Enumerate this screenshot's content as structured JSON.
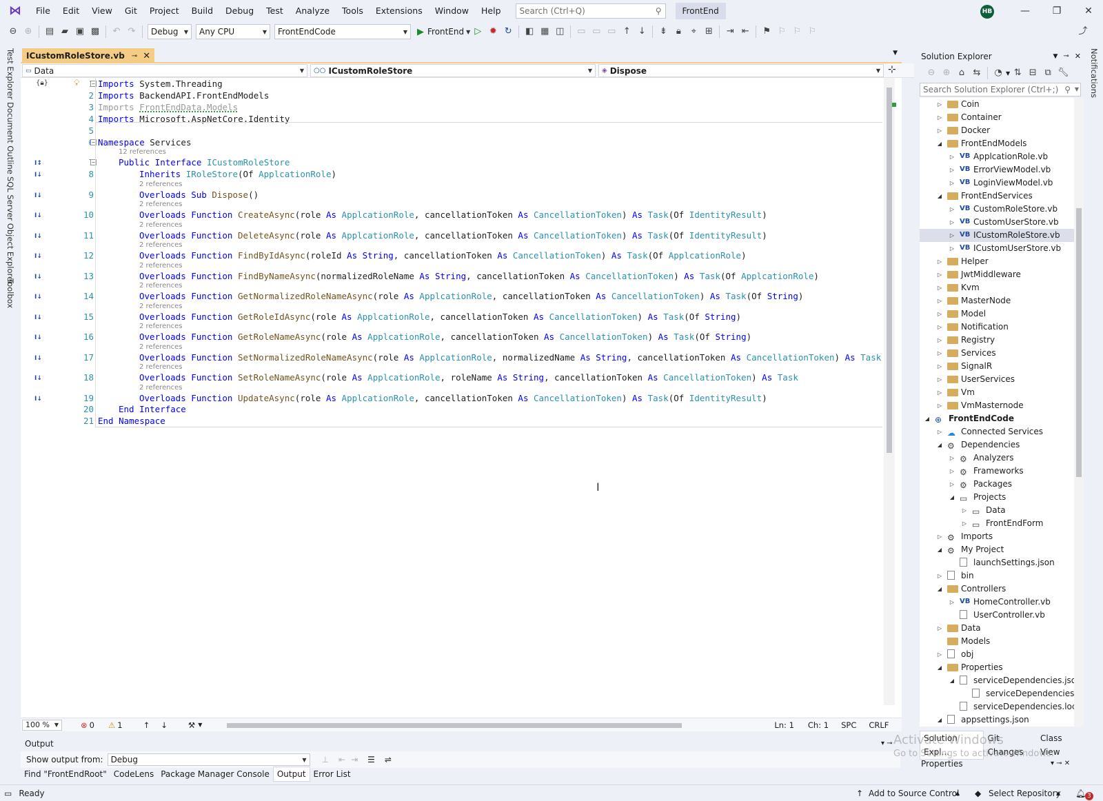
{
  "menu": [
    "File",
    "Edit",
    "View",
    "Git",
    "Project",
    "Build",
    "Debug",
    "Test",
    "Analyze",
    "Tools",
    "Extensions",
    "Window",
    "Help"
  ],
  "search": {
    "placeholder": "Search (Ctrl+Q)"
  },
  "solution_name": "FrontEnd",
  "user_initials": "HB",
  "toolbar": {
    "config": "Debug",
    "platform": "Any CPU",
    "startup_project": "FrontEndCode",
    "run_label": "FrontEnd"
  },
  "left_rail": [
    "Test Explorer",
    "Document Outline",
    "SQL Server Object Explorer",
    "Toolbox"
  ],
  "right_rail": [
    "Notifications"
  ],
  "editor": {
    "tab_title": "ICustomRoleStore.vb",
    "nav": {
      "project": "Data",
      "type": "ICustomRoleStore",
      "member": "Dispose"
    },
    "lines": [
      {
        "n": "1",
        "spans": [
          [
            "kw",
            "Imports"
          ],
          [
            "",
            "System.Threading"
          ]
        ]
      },
      {
        "n": "2",
        "spans": [
          [
            "kw",
            "Imports"
          ],
          [
            "",
            "BackendAPI.FrontEndModels"
          ]
        ]
      },
      {
        "n": "3",
        "spans": [
          [
            "dim",
            "Imports"
          ],
          [
            "dim",
            "FrontEndData.Models"
          ]
        ]
      },
      {
        "n": "4",
        "spans": [
          [
            "kw",
            "Imports"
          ],
          [
            "",
            "Microsoft.AspNetCore.Identity"
          ]
        ]
      },
      {
        "n": "5",
        "spans": []
      },
      {
        "n": "6",
        "spans": [
          [
            "kw",
            "Namespace"
          ],
          [
            "",
            "Services"
          ]
        ]
      },
      {
        "n": "7",
        "lens": "12 references",
        "spans": [
          [
            "kw",
            "Public Interface"
          ],
          [
            "ty",
            "ICustomRoleStore"
          ]
        ]
      },
      {
        "n": "8",
        "spans": [
          [
            "kw",
            "Inherits"
          ],
          [
            "ty",
            "IRoleStore"
          ],
          [
            "",
            "(Of "
          ],
          [
            "ty",
            "ApplcationRole"
          ],
          [
            "",
            ")"
          ]
        ]
      },
      {
        "n": "9",
        "lens": "2 references",
        "spans": [
          [
            "kw",
            "Overloads Sub"
          ],
          [
            "fn",
            "Dispose"
          ],
          [
            "",
            "()"
          ]
        ]
      },
      {
        "n": "10",
        "lens": "2 references",
        "spans": [
          [
            "kw",
            "Overloads Function"
          ],
          [
            "fn",
            "CreateAsync"
          ],
          [
            "",
            "(role "
          ],
          [
            "kw",
            "As"
          ],
          [
            "ty",
            "ApplcationRole"
          ],
          [
            "",
            ", cancellationToken "
          ],
          [
            "kw",
            "As"
          ],
          [
            "ty",
            "CancellationToken"
          ],
          [
            "",
            ") "
          ],
          [
            "kw",
            "As"
          ],
          [
            "ty",
            "Task"
          ],
          [
            "",
            "(Of "
          ],
          [
            "ty",
            "IdentityResult"
          ],
          [
            "",
            ")"
          ]
        ]
      },
      {
        "n": "11",
        "lens": "2 references",
        "spans": [
          [
            "kw",
            "Overloads Function"
          ],
          [
            "fn",
            "DeleteAsync"
          ],
          [
            "",
            "(role "
          ],
          [
            "kw",
            "As"
          ],
          [
            "ty",
            "ApplcationRole"
          ],
          [
            "",
            ", cancellationToken "
          ],
          [
            "kw",
            "As"
          ],
          [
            "ty",
            "CancellationToken"
          ],
          [
            "",
            ") "
          ],
          [
            "kw",
            "As"
          ],
          [
            "ty",
            "Task"
          ],
          [
            "",
            "(Of "
          ],
          [
            "ty",
            "IdentityResult"
          ],
          [
            "",
            ")"
          ]
        ]
      },
      {
        "n": "12",
        "lens": "2 references",
        "spans": [
          [
            "kw",
            "Overloads Function"
          ],
          [
            "fn",
            "FindByIdAsync"
          ],
          [
            "",
            "(roleId "
          ],
          [
            "kw",
            "As String"
          ],
          [
            "",
            ", cancellationToken "
          ],
          [
            "kw",
            "As"
          ],
          [
            "ty",
            "CancellationToken"
          ],
          [
            "",
            ") "
          ],
          [
            "kw",
            "As"
          ],
          [
            "ty",
            "Task"
          ],
          [
            "",
            "(Of "
          ],
          [
            "ty",
            "ApplcationRole"
          ],
          [
            "",
            ")"
          ]
        ]
      },
      {
        "n": "13",
        "lens": "2 references",
        "spans": [
          [
            "kw",
            "Overloads Function"
          ],
          [
            "fn",
            "FindByNameAsync"
          ],
          [
            "",
            "(normalizedRoleName "
          ],
          [
            "kw",
            "As String"
          ],
          [
            "",
            ", cancellationToken "
          ],
          [
            "kw",
            "As"
          ],
          [
            "ty",
            "CancellationToken"
          ],
          [
            "",
            ") "
          ],
          [
            "kw",
            "As"
          ],
          [
            "ty",
            "Task"
          ],
          [
            "",
            "(Of "
          ],
          [
            "ty",
            "ApplcationRole"
          ],
          [
            "",
            ")"
          ]
        ]
      },
      {
        "n": "14",
        "lens": "2 references",
        "spans": [
          [
            "kw",
            "Overloads Function"
          ],
          [
            "fn",
            "GetNormalizedRoleNameAsync"
          ],
          [
            "",
            "(role "
          ],
          [
            "kw",
            "As"
          ],
          [
            "ty",
            "ApplcationRole"
          ],
          [
            "",
            ", cancellationToken "
          ],
          [
            "kw",
            "As"
          ],
          [
            "ty",
            "CancellationToken"
          ],
          [
            "",
            ") "
          ],
          [
            "kw",
            "As"
          ],
          [
            "ty",
            "Task"
          ],
          [
            "",
            "(Of "
          ],
          [
            "kw",
            "String"
          ],
          [
            "",
            ")"
          ]
        ]
      },
      {
        "n": "15",
        "lens": "2 references",
        "spans": [
          [
            "kw",
            "Overloads Function"
          ],
          [
            "fn",
            "GetRoleIdAsync"
          ],
          [
            "",
            "(role "
          ],
          [
            "kw",
            "As"
          ],
          [
            "ty",
            "ApplcationRole"
          ],
          [
            "",
            ", cancellationToken "
          ],
          [
            "kw",
            "As"
          ],
          [
            "ty",
            "CancellationToken"
          ],
          [
            "",
            ") "
          ],
          [
            "kw",
            "As"
          ],
          [
            "ty",
            "Task"
          ],
          [
            "",
            "(Of "
          ],
          [
            "kw",
            "String"
          ],
          [
            "",
            ")"
          ]
        ]
      },
      {
        "n": "16",
        "lens": "2 references",
        "spans": [
          [
            "kw",
            "Overloads Function"
          ],
          [
            "fn",
            "GetRoleNameAsync"
          ],
          [
            "",
            "(role "
          ],
          [
            "kw",
            "As"
          ],
          [
            "ty",
            "ApplcationRole"
          ],
          [
            "",
            ", cancellationToken "
          ],
          [
            "kw",
            "As"
          ],
          [
            "ty",
            "CancellationToken"
          ],
          [
            "",
            ") "
          ],
          [
            "kw",
            "As"
          ],
          [
            "ty",
            "Task"
          ],
          [
            "",
            "(Of "
          ],
          [
            "kw",
            "String"
          ],
          [
            "",
            ")"
          ]
        ]
      },
      {
        "n": "17",
        "lens": "2 references",
        "spans": [
          [
            "kw",
            "Overloads Function"
          ],
          [
            "fn",
            "SetNormalizedRoleNameAsync"
          ],
          [
            "",
            "(role "
          ],
          [
            "kw",
            "As"
          ],
          [
            "ty",
            "ApplcationRole"
          ],
          [
            "",
            ", normalizedName "
          ],
          [
            "kw",
            "As String"
          ],
          [
            "",
            ", cancellationToken "
          ],
          [
            "kw",
            "As"
          ],
          [
            "ty",
            "CancellationToken"
          ],
          [
            "",
            ") "
          ],
          [
            "kw",
            "As"
          ],
          [
            "ty",
            "Task"
          ]
        ]
      },
      {
        "n": "18",
        "lens": "2 references",
        "spans": [
          [
            "kw",
            "Overloads Function"
          ],
          [
            "fn",
            "SetRoleNameAsync"
          ],
          [
            "",
            "(role "
          ],
          [
            "kw",
            "As"
          ],
          [
            "ty",
            "ApplcationRole"
          ],
          [
            "",
            ", roleName "
          ],
          [
            "kw",
            "As String"
          ],
          [
            "",
            ", cancellationToken "
          ],
          [
            "kw",
            "As"
          ],
          [
            "ty",
            "CancellationToken"
          ],
          [
            "",
            ") "
          ],
          [
            "kw",
            "As"
          ],
          [
            "ty",
            "Task"
          ]
        ]
      },
      {
        "n": "19",
        "lens": "2 references",
        "spans": [
          [
            "kw",
            "Overloads Function"
          ],
          [
            "fn",
            "UpdateAsync"
          ],
          [
            "",
            "(role "
          ],
          [
            "kw",
            "As"
          ],
          [
            "ty",
            "ApplcationRole"
          ],
          [
            "",
            ", cancellationToken "
          ],
          [
            "kw",
            "As"
          ],
          [
            "ty",
            "CancellationToken"
          ],
          [
            "",
            ") "
          ],
          [
            "kw",
            "As"
          ],
          [
            "ty",
            "Task"
          ],
          [
            "",
            "(Of "
          ],
          [
            "ty",
            "IdentityResult"
          ],
          [
            "",
            ")"
          ]
        ]
      },
      {
        "n": "20",
        "spans": [
          [
            "kw",
            "End Interface"
          ]
        ]
      },
      {
        "n": "21",
        "spans": [
          [
            "kw",
            "End Namespace"
          ]
        ]
      }
    ],
    "status": {
      "zoom": "100 %",
      "errors": "0",
      "warnings": "1",
      "ln": "Ln: 1",
      "ch": "Ch: 1",
      "spc": "SPC",
      "eol": "CRLF"
    }
  },
  "output": {
    "title": "Output",
    "show_from_label": "Show output from:",
    "source": "Debug"
  },
  "bottom_tabs": [
    "Find \"FrontEndRoot\"",
    "CodeLens",
    "Package Manager Console",
    "Output",
    "Error List"
  ],
  "status_bar": {
    "ready": "Ready",
    "source_control": "Add to Source Control",
    "repo": "Select Repository",
    "notifications": "3"
  },
  "solution_explorer": {
    "title": "Solution Explorer",
    "search_placeholder": "Search Solution Explorer (Ctrl+;)",
    "items": [
      {
        "label": "Coin",
        "level": 2,
        "type": "folder",
        "arrow": "collapsed"
      },
      {
        "label": "Container",
        "level": 2,
        "type": "folder",
        "arrow": "collapsed"
      },
      {
        "label": "Docker",
        "level": 2,
        "type": "folder",
        "arrow": "collapsed"
      },
      {
        "label": "FrontEndModels",
        "level": 2,
        "type": "folder",
        "arrow": "expanded"
      },
      {
        "label": "ApplcationRole.vb",
        "level": 3,
        "type": "vb",
        "arrow": "collapsed"
      },
      {
        "label": "ErrorViewModel.vb",
        "level": 3,
        "type": "vb",
        "arrow": "collapsed"
      },
      {
        "label": "LoginViewModel.vb",
        "level": 3,
        "type": "vb",
        "arrow": "collapsed"
      },
      {
        "label": "FrontEndServices",
        "level": 2,
        "type": "folder",
        "arrow": "expanded"
      },
      {
        "label": "CustomRoleStore.vb",
        "level": 3,
        "type": "vb",
        "arrow": "collapsed"
      },
      {
        "label": "CustomUserStore.vb",
        "level": 3,
        "type": "vb",
        "arrow": "collapsed"
      },
      {
        "label": "ICustomRoleStore.vb",
        "level": 3,
        "type": "vb",
        "arrow": "collapsed",
        "selected": true
      },
      {
        "label": "ICustomUserStore.vb",
        "level": 3,
        "type": "vb",
        "arrow": "collapsed"
      },
      {
        "label": "Helper",
        "level": 2,
        "type": "folder",
        "arrow": "collapsed"
      },
      {
        "label": "JwtMiddleware",
        "level": 2,
        "type": "folder",
        "arrow": "collapsed"
      },
      {
        "label": "Kvm",
        "level": 2,
        "type": "folder",
        "arrow": "collapsed"
      },
      {
        "label": "MasterNode",
        "level": 2,
        "type": "folder",
        "arrow": "collapsed"
      },
      {
        "label": "Model",
        "level": 2,
        "type": "folder",
        "arrow": "collapsed"
      },
      {
        "label": "Notification",
        "level": 2,
        "type": "folder",
        "arrow": "collapsed"
      },
      {
        "label": "Registry",
        "level": 2,
        "type": "folder",
        "arrow": "collapsed"
      },
      {
        "label": "Services",
        "level": 2,
        "type": "folder",
        "arrow": "collapsed"
      },
      {
        "label": "SignalR",
        "level": 2,
        "type": "folder",
        "arrow": "collapsed"
      },
      {
        "label": "UserServices",
        "level": 2,
        "type": "folder",
        "arrow": "collapsed"
      },
      {
        "label": "Vm",
        "level": 2,
        "type": "folder",
        "arrow": "collapsed"
      },
      {
        "label": "VmMasternode",
        "level": 2,
        "type": "folder",
        "arrow": "collapsed"
      },
      {
        "label": "FrontEndCode",
        "level": 1,
        "type": "project",
        "arrow": "expanded",
        "bold": true
      },
      {
        "label": "Connected Services",
        "level": 2,
        "type": "service",
        "arrow": "collapsed"
      },
      {
        "label": "Dependencies",
        "level": 2,
        "type": "deps",
        "arrow": "expanded"
      },
      {
        "label": "Analyzers",
        "level": 3,
        "type": "deps",
        "arrow": "collapsed"
      },
      {
        "label": "Frameworks",
        "level": 3,
        "type": "deps",
        "arrow": "collapsed"
      },
      {
        "label": "Packages",
        "level": 3,
        "type": "deps",
        "arrow": "collapsed"
      },
      {
        "label": "Projects",
        "level": 3,
        "type": "box",
        "arrow": "expanded"
      },
      {
        "label": "Data",
        "level": 4,
        "type": "box",
        "arrow": "collapsed"
      },
      {
        "label": "FrontEndForm",
        "level": 4,
        "type": "box",
        "arrow": "collapsed"
      },
      {
        "label": "Imports",
        "level": 2,
        "type": "deps",
        "arrow": "collapsed"
      },
      {
        "label": "My Project",
        "level": 2,
        "type": "deps",
        "arrow": "expanded"
      },
      {
        "label": "launchSettings.json",
        "level": 3,
        "type": "file",
        "arrow": "none"
      },
      {
        "label": "bin",
        "level": 2,
        "type": "file",
        "arrow": "collapsed"
      },
      {
        "label": "Controllers",
        "level": 2,
        "type": "folder",
        "arrow": "expanded"
      },
      {
        "label": "HomeController.vb",
        "level": 3,
        "type": "vb",
        "arrow": "collapsed"
      },
      {
        "label": "UserController.vb",
        "level": 3,
        "type": "file",
        "arrow": "none"
      },
      {
        "label": "Data",
        "level": 2,
        "type": "folder",
        "arrow": "collapsed"
      },
      {
        "label": "Models",
        "level": 2,
        "type": "folder",
        "arrow": "none"
      },
      {
        "label": "obj",
        "level": 2,
        "type": "file",
        "arrow": "collapsed"
      },
      {
        "label": "Properties",
        "level": 2,
        "type": "folder",
        "arrow": "expanded"
      },
      {
        "label": "serviceDependencies.json",
        "level": 3,
        "type": "file",
        "arrow": "expanded"
      },
      {
        "label": "serviceDependencies",
        "level": 4,
        "type": "file",
        "arrow": "none"
      },
      {
        "label": "serviceDependencies.loc",
        "level": 3,
        "type": "file",
        "arrow": "none"
      },
      {
        "label": "appsettings.json",
        "level": 2,
        "type": "file",
        "arrow": "expanded"
      }
    ],
    "tabs": [
      "Solution Expl...",
      "Git Changes",
      "Class View"
    ]
  },
  "properties": {
    "title": "Properties"
  },
  "watermark": {
    "line1": "Activate Windows",
    "line2": "Go to Settings to activate Windows."
  }
}
